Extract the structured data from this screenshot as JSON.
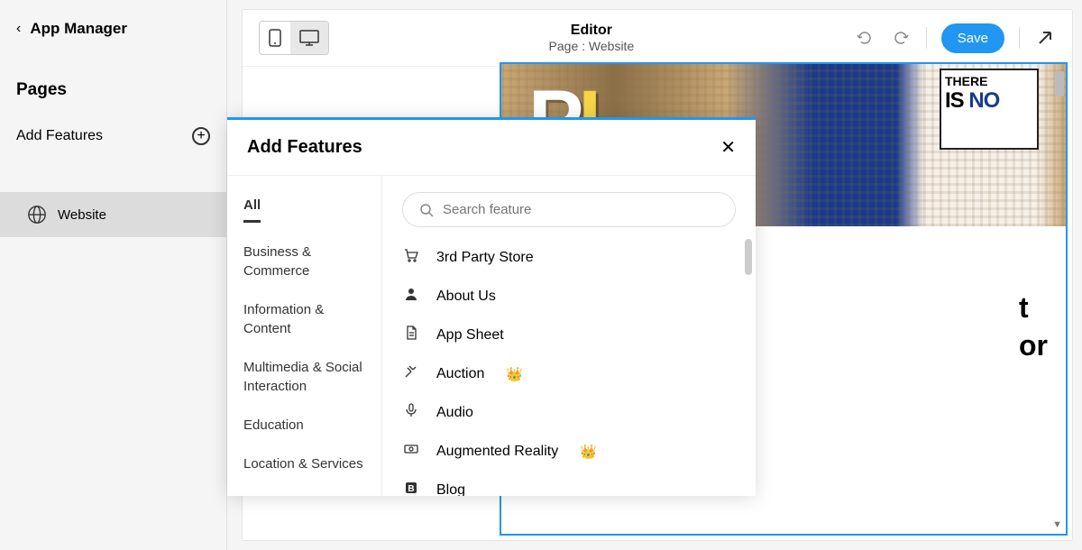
{
  "sidebar": {
    "back_label": "App Manager",
    "pages_label": "Pages",
    "add_features_label": "Add Features",
    "items": [
      {
        "label": "Website"
      }
    ]
  },
  "topbar": {
    "title": "Editor",
    "subtitle": "Page : Website",
    "save_label": "Save"
  },
  "canvas": {
    "poster_line1": "THERE",
    "poster_line2_a": "IS ",
    "poster_line2_b": "NO",
    "body_text_1": "t",
    "body_text_2": "or"
  },
  "modal": {
    "title": "Add Features",
    "search_placeholder": "Search feature",
    "categories": [
      "All",
      "Business & Commerce",
      "Information & Content",
      "Multimedia & Social Interaction",
      "Education",
      "Location & Services"
    ],
    "features": [
      {
        "icon": "cart",
        "name": "3rd Party Store",
        "premium": false
      },
      {
        "icon": "person",
        "name": "About Us",
        "premium": false
      },
      {
        "icon": "sheet",
        "name": "App Sheet",
        "premium": false
      },
      {
        "icon": "gavel",
        "name": "Auction",
        "premium": true
      },
      {
        "icon": "mic",
        "name": "Audio",
        "premium": false
      },
      {
        "icon": "ar",
        "name": "Augmented Reality",
        "premium": true
      },
      {
        "icon": "blog",
        "name": "Blog",
        "premium": false
      }
    ]
  }
}
